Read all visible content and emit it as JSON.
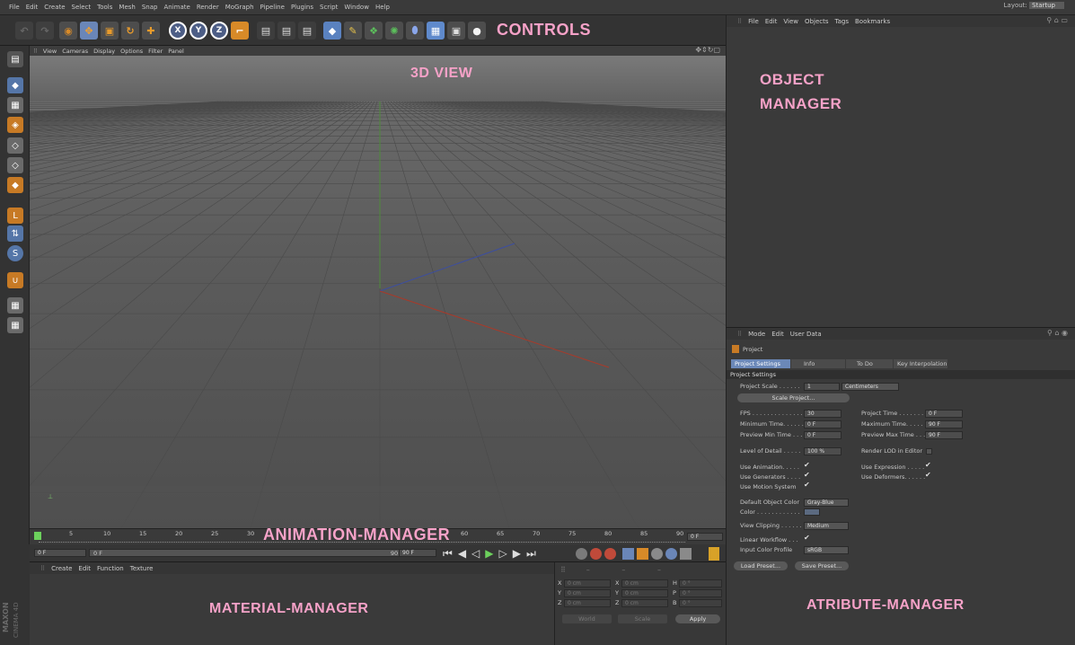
{
  "menubar": {
    "items": [
      "File",
      "Edit",
      "Create",
      "Select",
      "Tools",
      "Mesh",
      "Snap",
      "Animate",
      "Render",
      "MoGraph",
      "Pipeline",
      "Plugins",
      "Script",
      "Window",
      "Help"
    ],
    "layout_label": "Layout:",
    "layout_value": "Startup"
  },
  "annotations": {
    "controls": "CONTROLS",
    "view3d": "3D VIEW",
    "object_manager_1": "OBJECT",
    "object_manager_2": "MANAGER",
    "animation_manager": "ANIMATION-MANAGER",
    "material_manager": "MATERIAL-MANAGER",
    "attribute_manager": "ATRIBUTE-MANAGER"
  },
  "viewport": {
    "menu": [
      "View",
      "Cameras",
      "Display",
      "Options",
      "Filter",
      "Panel"
    ]
  },
  "timeline": {
    "ticks": [
      "0",
      "5",
      "10",
      "15",
      "20",
      "25",
      "30",
      "60",
      "65",
      "70",
      "75",
      "80",
      "85",
      "90"
    ],
    "end_field": "0 F"
  },
  "playbar": {
    "start_field": "0 F",
    "min_field": "0 F",
    "max_field": "90 F",
    "end_field": "90 F"
  },
  "material_manager": {
    "menu": [
      "Create",
      "Edit",
      "Function",
      "Texture"
    ]
  },
  "coord_manager": {
    "rows": [
      {
        "a": "X",
        "av": "0 cm",
        "b": "X",
        "bv": "0 cm",
        "c": "H",
        "cv": "0 °"
      },
      {
        "a": "Y",
        "av": "0 cm",
        "b": "Y",
        "bv": "0 cm",
        "c": "P",
        "cv": "0 °"
      },
      {
        "a": "Z",
        "av": "0 cm",
        "b": "Z",
        "bv": "0 cm",
        "c": "B",
        "cv": "0 °"
      }
    ],
    "mode": "World",
    "scale": "Scale",
    "apply": "Apply"
  },
  "logo": {
    "line1": "MAXON",
    "line2": "CINEMA 4D"
  },
  "object_manager": {
    "menu": [
      "File",
      "Edit",
      "View",
      "Objects",
      "Tags",
      "Bookmarks"
    ]
  },
  "attribute_manager": {
    "menu": [
      "Mode",
      "Edit",
      "User Data"
    ],
    "object": "Project",
    "tabs": [
      "Project Settings",
      "Info",
      "To Do",
      "Key Interpolation"
    ],
    "section": "Project Settings",
    "project_scale_label": "Project Scale . . . . . .",
    "project_scale_value": "1",
    "project_scale_unit": "Centimeters",
    "scale_project_btn": "Scale Project...",
    "fps_label": "FPS . . . . . . . . . . . . . .",
    "fps_value": "30",
    "min_time_label": "Minimum Time. . . . . .",
    "min_time_value": "0 F",
    "preview_min_label": "Preview Min Time . . .",
    "preview_min_value": "0 F",
    "project_time_label": "Project Time . . . . . . . .",
    "project_time_value": "0 F",
    "max_time_label": "Maximum Time. . . . . .",
    "max_time_value": "90 F",
    "preview_max_label": "Preview Max Time . . .",
    "preview_max_value": "90 F",
    "lod_label": "Level of Detail . . . . .",
    "lod_value": "100 %",
    "render_lod_label": "Render LOD in Editor",
    "use_anim_label": "Use Animation. . . . .",
    "use_gen_label": "Use Generators . . . .",
    "use_motion_label": "Use Motion System",
    "use_expr_label": "Use Expression . . . . .",
    "use_deform_label": "Use Deformers. . . . . .",
    "default_color_label": "Default Object Color",
    "default_color_value": "Gray-Blue",
    "color_label": "Color . . . . . . . . . . . .",
    "view_clipping_label": "View Clipping . . . . . .",
    "view_clipping_value": "Medium",
    "linear_label": "Linear Workflow . . .",
    "profile_label": "Input Color Profile",
    "profile_value": "sRGB",
    "load_preset": "Load Preset...",
    "save_preset": "Save Preset..."
  },
  "colors": {
    "accent": "#6b88b8",
    "annotation": "#f6a2c8",
    "orange": "#d88a28"
  }
}
